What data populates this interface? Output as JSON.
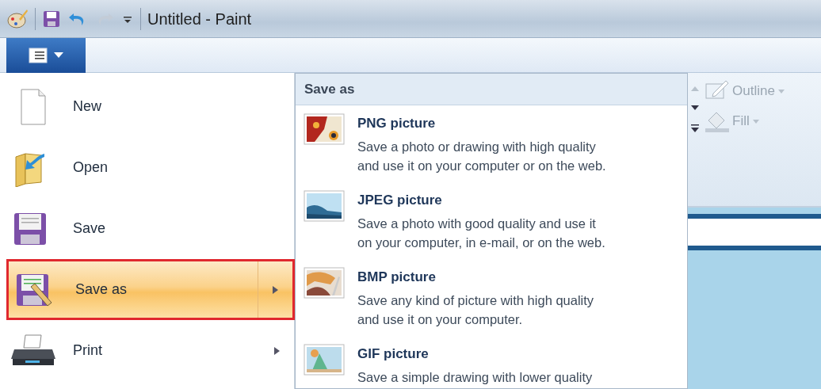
{
  "window": {
    "title": "Untitled - Paint"
  },
  "file_menu": {
    "items": [
      {
        "kind": "new",
        "label": "New",
        "selected": false,
        "has_submenu": false
      },
      {
        "kind": "open",
        "label": "Open",
        "selected": false,
        "has_submenu": false
      },
      {
        "kind": "save",
        "label": "Save",
        "selected": false,
        "has_submenu": false
      },
      {
        "kind": "saveas",
        "label": "Save as",
        "selected": true,
        "has_submenu": true
      },
      {
        "kind": "print",
        "label": "Print",
        "selected": false,
        "has_submenu": true
      }
    ]
  },
  "save_as_panel": {
    "title": "Save as",
    "options": [
      {
        "kind": "png",
        "label": "PNG picture",
        "description_lines": [
          "Save a photo or drawing with high quality",
          "and use it on your computer or on the web."
        ]
      },
      {
        "kind": "jpeg",
        "label": "JPEG picture",
        "description_lines": [
          "Save a photo with good quality and use it",
          "on your computer, in e-mail, or on the web."
        ]
      },
      {
        "kind": "bmp",
        "label": "BMP picture",
        "description_lines": [
          "Save any kind of picture with high quality",
          "and use it on your computer."
        ]
      },
      {
        "kind": "gif",
        "label": "GIF picture",
        "description_lines": [
          "Save a simple drawing with lower quality"
        ]
      }
    ]
  },
  "ribbon": {
    "tools": [
      {
        "kind": "outline",
        "label": "Outline",
        "disabled": true
      },
      {
        "kind": "fill",
        "label": "Fill",
        "disabled": true
      }
    ]
  }
}
